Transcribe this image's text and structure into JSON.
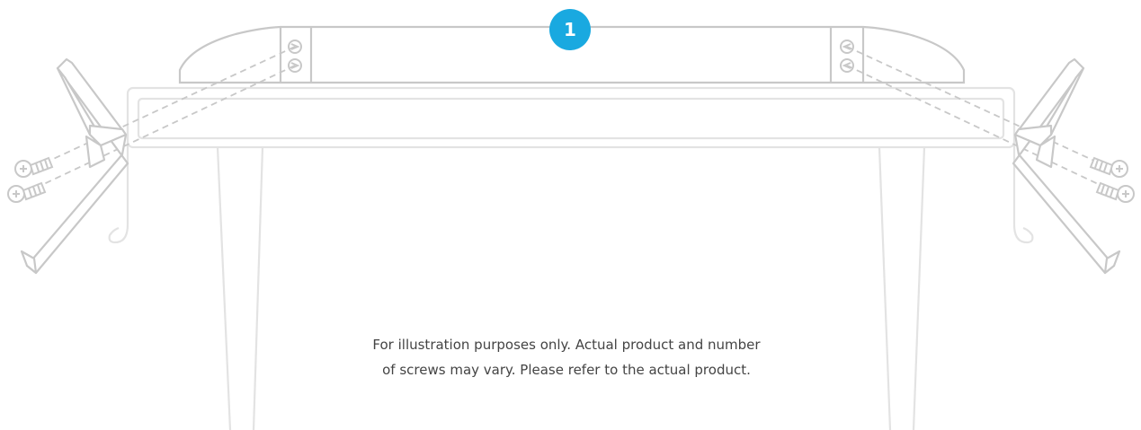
{
  "step": {
    "number": "1"
  },
  "caption": {
    "line1": "For illustration purposes only. Actual product and number",
    "line2": "of screws may vary. Please refer to the actual product."
  },
  "colors": {
    "accent": "#19a9e0",
    "tv_outline": "#e3e3e3",
    "stand_outline": "#c8c8c8",
    "caption_text": "#444444"
  },
  "icons": {
    "screw": "screw-icon",
    "stand_leg": "stand-leg-icon"
  }
}
